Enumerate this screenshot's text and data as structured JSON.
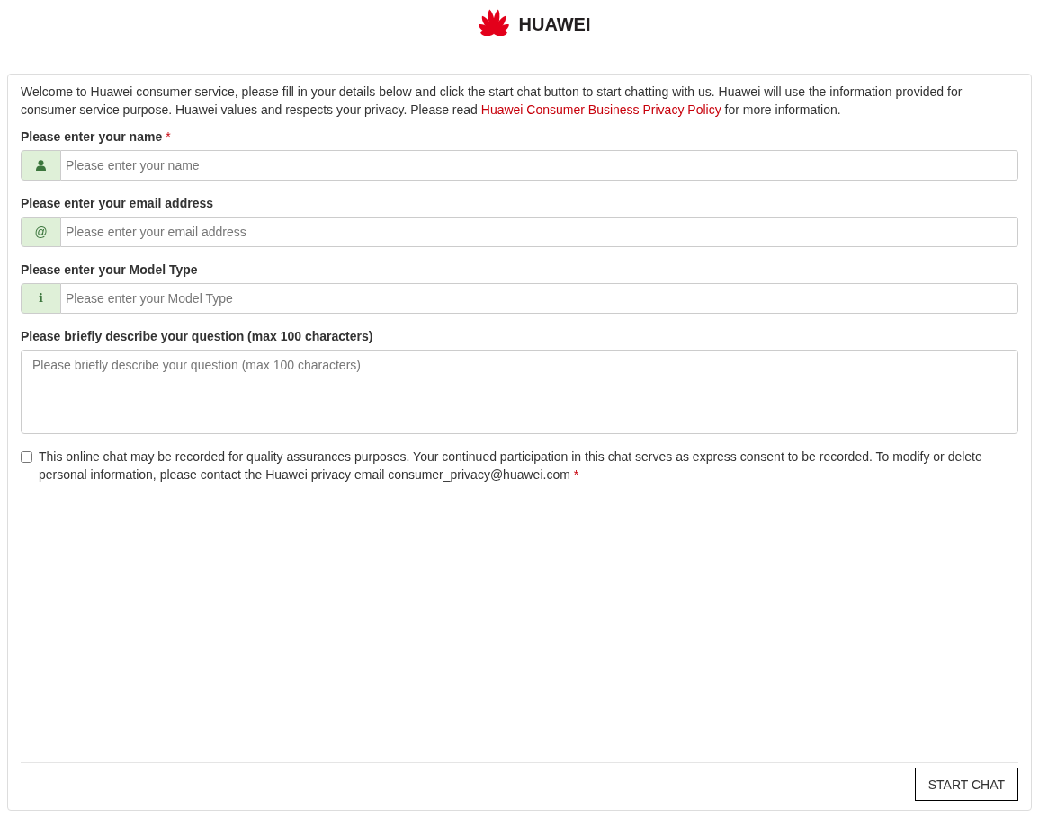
{
  "header": {
    "logo_text": "HUAWEI"
  },
  "intro": {
    "text": "Welcome to Huawei consumer service, please fill in your details below and click the start chat button to start chatting with us. Huawei will use the information provided for consumer service purpose. Huawei values and respects your privacy. Please read ",
    "link": "Huawei Consumer Business Privacy Policy",
    "after": " for more information."
  },
  "fields": [
    {
      "kind": "input",
      "label": "Please enter your name",
      "required_mark": "*",
      "addon": {
        "kind": "person"
      },
      "placeholder": "Please enter your name"
    },
    {
      "kind": "input",
      "label": "Please enter your email address",
      "addon": {
        "kind": "at",
        "text": "@"
      },
      "placeholder": "Please enter your email address"
    },
    {
      "kind": "input",
      "label": "Please enter your Model Type",
      "addon": {
        "kind": "info",
        "text": "i"
      },
      "placeholder": "Please enter your Model Type"
    },
    {
      "kind": "textarea",
      "label": "Please briefly describe your question (max 100 characters)",
      "placeholder": "Please briefly describe your question (max 100 characters)"
    }
  ],
  "consent": {
    "checked": false,
    "text": "This online chat may be recorded for quality assurances purposes. Your continued participation in this chat serves as express consent to be recorded. To modify or delete personal information, please contact the Huawei privacy email consumer_privacy@huawei.com",
    "required_mark": "*"
  },
  "footer": {
    "button": "START CHAT"
  }
}
